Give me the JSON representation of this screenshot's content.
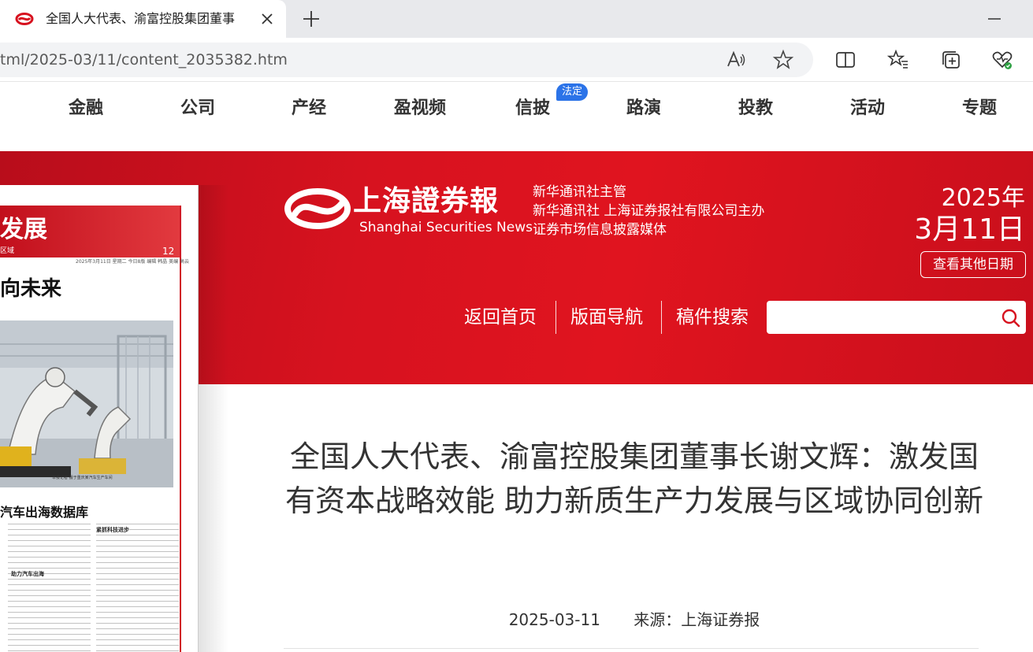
{
  "browser": {
    "tab_title": "全国人大代表、渝富控股集团董事",
    "address": "tml/2025-03/11/content_2035382.htm",
    "icons": [
      "site-favicon",
      "close-icon",
      "plus-icon",
      "minimize-icon",
      "read-aloud-icon",
      "favorite-star-icon",
      "split-screen-icon",
      "favorites-list-icon",
      "collections-icon",
      "browser-essentials-icon"
    ]
  },
  "site_nav": {
    "items": [
      {
        "label": "金融"
      },
      {
        "label": "公司"
      },
      {
        "label": "产经"
      },
      {
        "label": "盈视频"
      },
      {
        "label": "信披",
        "badge": "法定"
      },
      {
        "label": "路演"
      },
      {
        "label": "投教"
      },
      {
        "label": "活动"
      },
      {
        "label": "专题"
      }
    ]
  },
  "banner": {
    "logo_cn": "上海證券報",
    "logo_en": "Shanghai Securities News",
    "subtitle_lines": [
      "新华通讯社主管",
      "新华通讯社 上海证券报社有限公司主办",
      "证券市场信息披露媒体"
    ],
    "date_year": "2025年",
    "date_day": "3月11日",
    "other_date_label": "查看其他日期",
    "links": [
      "返回首页",
      "版面导航",
      "稿件搜索"
    ],
    "search_placeholder": "",
    "colors": {
      "banner_red": "#d7121f",
      "badge_blue": "#2b73e8"
    }
  },
  "newspaper": {
    "header_title": "发展",
    "region_label": "区域",
    "page_number": "12",
    "dateline": "2025年3月11日 星期二 今日8版 编辑 韩晶 美编 高云",
    "headline": "向未来",
    "subhead": "汽车出海数据库",
    "col_head_1": "助力汽车出海",
    "col_head_2": "紧抓科技进步",
    "caption": "本报记者 摄于重庆某汽车生产车间"
  },
  "article": {
    "title": "全国人大代表、渝富控股集团董事长谢文辉：激发国有资本战略效能 助力新质生产力发展与区域协同创新",
    "date": "2025-03-11",
    "source": "来源：上海证券报"
  }
}
